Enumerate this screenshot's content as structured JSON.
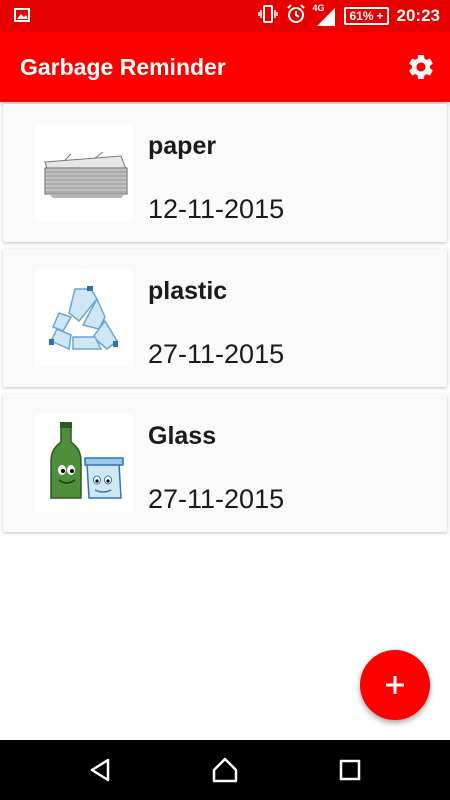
{
  "status_bar": {
    "time": "20:23",
    "battery_percent": "61%",
    "network_type": "4G",
    "icons": [
      "image-icon",
      "vibrate-icon",
      "alarm-icon",
      "signal-icon",
      "battery-icon"
    ]
  },
  "app_bar": {
    "title": "Garbage Reminder",
    "settings_icon": "gear-icon",
    "color": "#ff0000"
  },
  "items": [
    {
      "name": "paper",
      "date": "12-11-2015",
      "icon": "paper-stack-icon"
    },
    {
      "name": "plastic",
      "date": "27-11-2015",
      "icon": "plastic-bottles-icon"
    },
    {
      "name": "Glass",
      "date": "27-11-2015",
      "icon": "glass-bottle-jar-icon"
    }
  ],
  "fab": {
    "icon": "plus-icon",
    "color": "#ff0000"
  },
  "nav_bar": {
    "icons": [
      "back-icon",
      "home-icon",
      "recents-icon"
    ]
  }
}
